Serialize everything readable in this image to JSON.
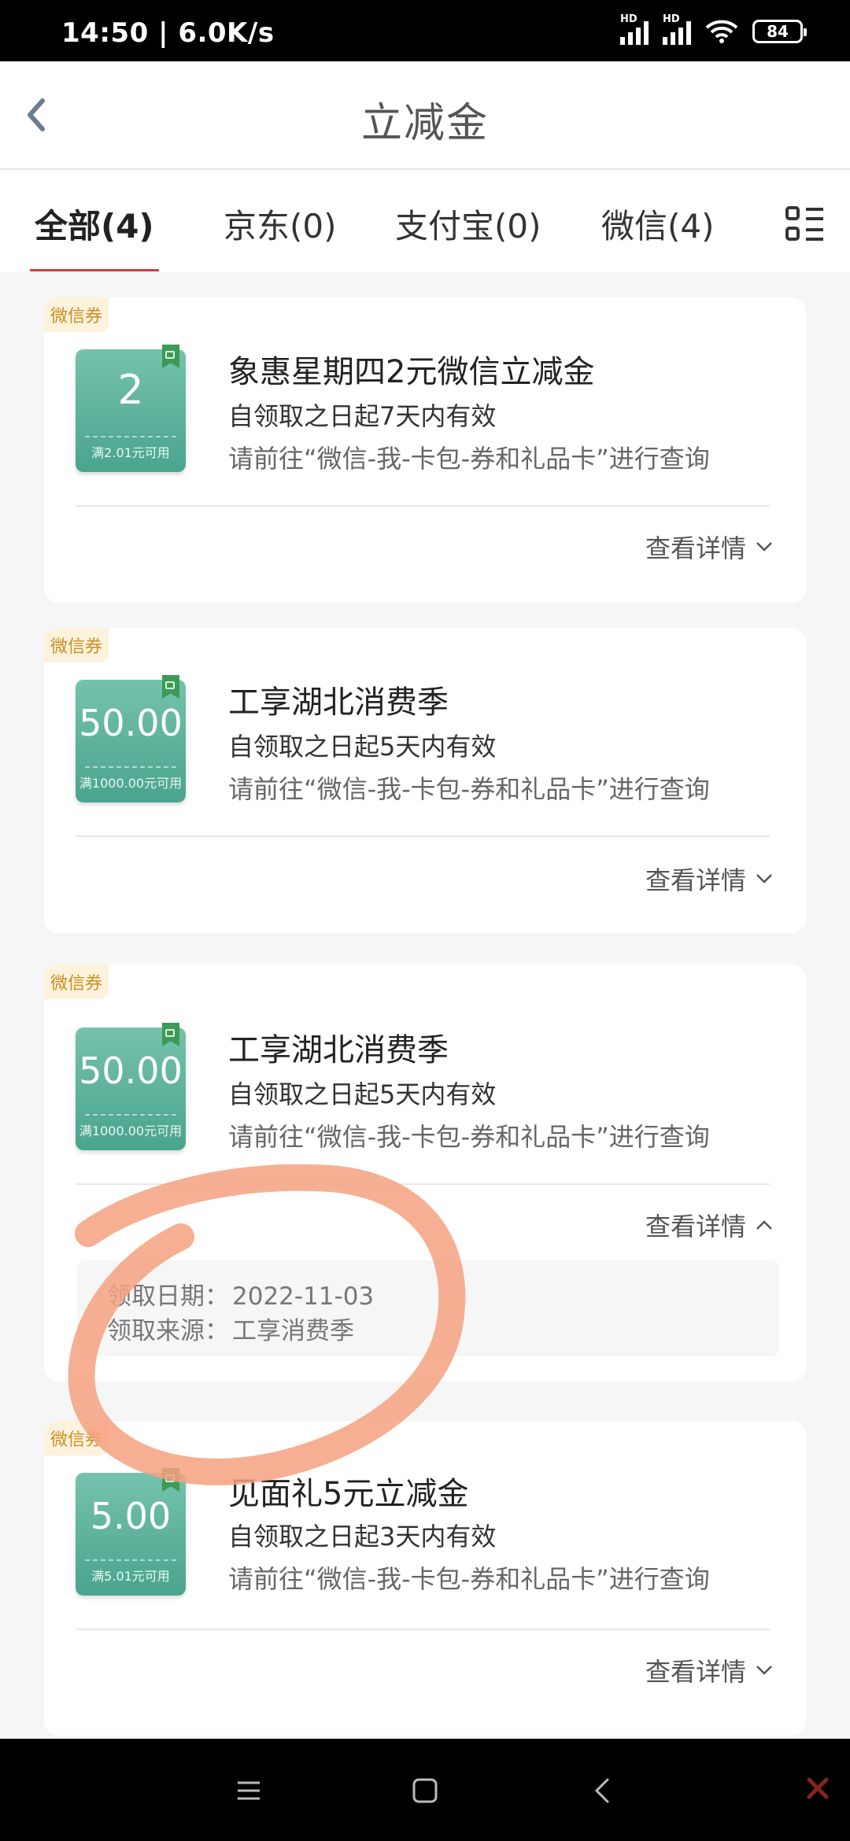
{
  "status_bar": {
    "time": "14:50 | 6.0K/s",
    "battery": "84"
  },
  "header": {
    "title": "立减金"
  },
  "tabs": [
    {
      "label": "全部(4)",
      "active": true
    },
    {
      "label": "京东(0)",
      "active": false
    },
    {
      "label": "支付宝(0)",
      "active": false
    },
    {
      "label": "微信(4)",
      "active": false
    }
  ],
  "coupons": [
    {
      "badge": "微信券",
      "amount": "2",
      "condition": "满2.01元可用",
      "title": "象惠星期四2元微信立减金",
      "validity": "自领取之日起7天内有效",
      "hint": "请前往“微信-我-卡包-券和礼品卡”进行查询",
      "detail_label": "查看详情",
      "expanded": false
    },
    {
      "badge": "微信券",
      "amount": "50.00",
      "condition": "满1000.00元可用",
      "title": "工享湖北消费季",
      "validity": "自领取之日起5天内有效",
      "hint": "请前往“微信-我-卡包-券和礼品卡”进行查询",
      "detail_label": "查看详情",
      "expanded": false
    },
    {
      "badge": "微信券",
      "amount": "50.00",
      "condition": "满1000.00元可用",
      "title": "工享湖北消费季",
      "validity": "自领取之日起5天内有效",
      "hint": "请前往“微信-我-卡包-券和礼品卡”进行查询",
      "detail_label": "查看详情",
      "expanded": true,
      "details": {
        "date_label": "领取日期：",
        "date_value": "2022-11-03",
        "source_label": "领取来源：",
        "source_value": "工享消费季"
      }
    },
    {
      "badge": "微信券",
      "amount": "5.00",
      "condition": "满5.01元可用",
      "title": "见面礼5元立减金",
      "validity": "自领取之日起3天内有效",
      "hint": "请前往“微信-我-卡包-券和礼品卡”进行查询",
      "detail_label": "查看详情",
      "expanded": false
    }
  ],
  "colors": {
    "accent": "#d93a3a",
    "coupon": "#5bb39c",
    "badge_text": "#c99024",
    "annotation": "#f4a17f"
  },
  "icons": {
    "back": "chevron-left-icon",
    "grid": "list-grid-icon",
    "chevron_down": "chevron-down-icon",
    "chevron_up": "chevron-up-icon"
  }
}
